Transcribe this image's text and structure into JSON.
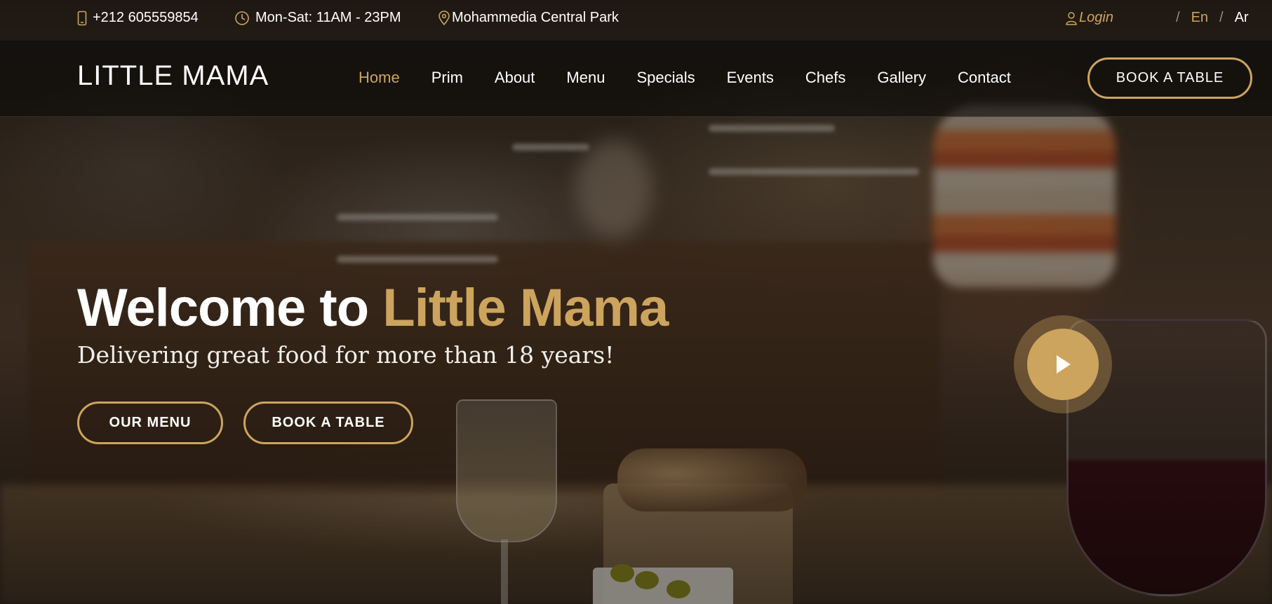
{
  "topbar": {
    "phone": "+212 605559854",
    "hours": "Mon-Sat: 11AM - 23PM",
    "location": "Mohammedia Central Park",
    "login": "Login",
    "languages": {
      "en": "En",
      "ar": "Ar",
      "separator": "/"
    }
  },
  "header": {
    "logo": "LITTLE MAMA",
    "nav": [
      "Home",
      "Prim",
      "About",
      "Menu",
      "Specials",
      "Events",
      "Chefs",
      "Gallery",
      "Contact"
    ],
    "active_nav": "Home",
    "book_button": "BOOK A TABLE"
  },
  "hero": {
    "title_prefix": "Welcome to",
    "title_accent": "Little Mama",
    "subtitle": "Delivering great food for more than 18 years!",
    "menu_button": "OUR MENU",
    "book_button": "BOOK A TABLE"
  },
  "colors": {
    "accent": "#cda45e",
    "text": "#ffffff",
    "header_bg": "rgba(12,11,9,0.62)"
  },
  "icons": {
    "phone": "phone-icon",
    "hours": "clock-icon",
    "location": "map-pin-icon",
    "login": "user-icon",
    "play": "play-icon"
  }
}
